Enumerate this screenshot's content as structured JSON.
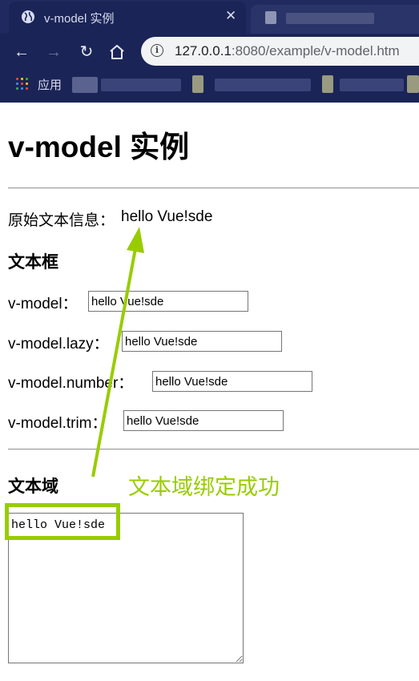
{
  "browser": {
    "tab_title": "v-model 实例",
    "tab_close": "✕",
    "url_host": "127.0.0.1",
    "url_rest": ":8080/example/v-model.htm",
    "bookmarks_label": "应用",
    "accent_color": "#202a5e"
  },
  "page": {
    "title": "v-model 实例",
    "original_label": "原始文本信息：",
    "original_value": "hello Vue!sde",
    "section_input": "文本框",
    "fields": [
      {
        "label": "v-model：",
        "value": "hello Vue!sde"
      },
      {
        "label": "v-model.lazy：",
        "value": "hello Vue!sde"
      },
      {
        "label": "v-model.number：",
        "value": "hello Vue!sde"
      },
      {
        "label": "v-model.trim：",
        "value": "hello Vue!sde"
      }
    ],
    "section_textarea": "文本域",
    "textarea_value": "hello Vue!sde"
  },
  "annotation": {
    "text": "文本域绑定成功",
    "color": "#99cc00"
  }
}
